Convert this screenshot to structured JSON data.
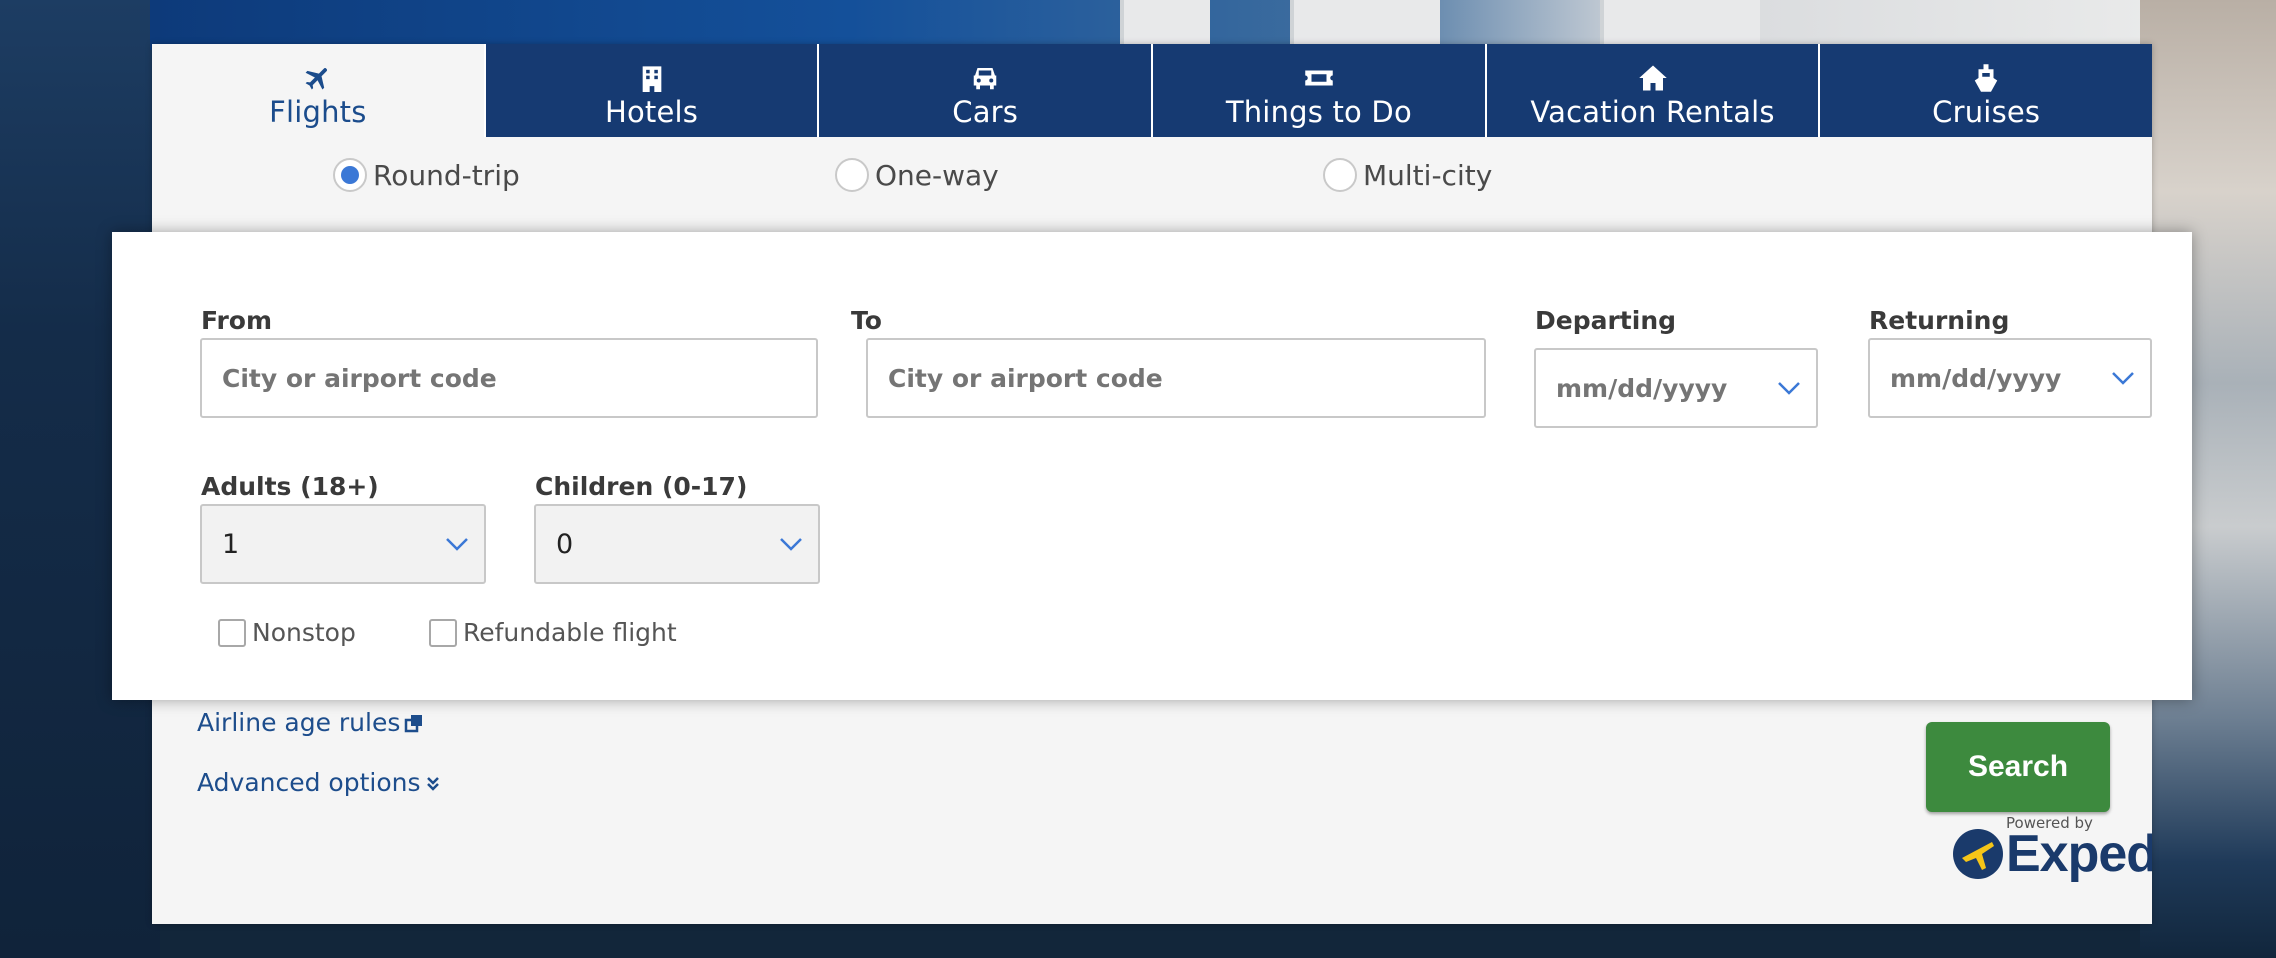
{
  "tabs": [
    {
      "label": "Flights",
      "icon": "plane-icon",
      "active": true
    },
    {
      "label": "Hotels",
      "icon": "building-icon",
      "active": false
    },
    {
      "label": "Cars",
      "icon": "car-icon",
      "active": false
    },
    {
      "label": "Things to Do",
      "icon": "ticket-icon",
      "active": false
    },
    {
      "label": "Vacation Rentals",
      "icon": "house-icon",
      "active": false
    },
    {
      "label": "Cruises",
      "icon": "ship-icon",
      "active": false
    }
  ],
  "trip_type": {
    "options": [
      "Round-trip",
      "One-way",
      "Multi-city"
    ],
    "selected": "Round-trip"
  },
  "form": {
    "from": {
      "label": "From",
      "placeholder": "City or airport code",
      "value": ""
    },
    "to": {
      "label": "To",
      "placeholder": "City or airport code",
      "value": ""
    },
    "departing": {
      "label": "Departing",
      "value": "mm/dd/yyyy"
    },
    "returning": {
      "label": "Returning",
      "value": "mm/dd/yyyy"
    },
    "adults": {
      "label": "Adults (18+)",
      "value": "1"
    },
    "children": {
      "label": "Children (0-17)",
      "value": "0"
    },
    "nonstop": {
      "label": "Nonstop",
      "checked": false
    },
    "refundable": {
      "label": "Refundable flight",
      "checked": false
    }
  },
  "links": {
    "airline_age_rules": "Airline age rules",
    "advanced_options": "Advanced options"
  },
  "search_button": "Search",
  "powered_by": {
    "text": "Powered by",
    "brand": "Expedia"
  },
  "colors": {
    "tab_bg": "#163a72",
    "link": "#1d4d8c",
    "search_bg": "#3d8a3e",
    "radio_selected": "#3b78d6"
  }
}
